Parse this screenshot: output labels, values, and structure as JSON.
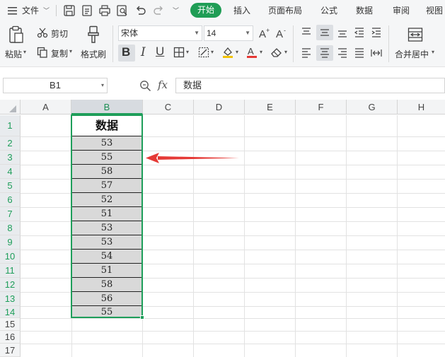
{
  "menubar": {
    "file_label": "文件",
    "tabs": [
      "开始",
      "插入",
      "页面布局",
      "公式",
      "数据",
      "审阅",
      "视图"
    ]
  },
  "ribbon": {
    "paste_label": "粘贴",
    "cut_label": "剪切",
    "copy_label": "复制",
    "format_painter_label": "格式刷",
    "font_name": "宋体",
    "font_size": "14",
    "merge_center_label": "合并居中"
  },
  "formula_bar": {
    "cell_ref": "B1",
    "fx_label": "fx",
    "content": "数据"
  },
  "sheet": {
    "columns": [
      "A",
      "B",
      "C",
      "D",
      "E",
      "F",
      "G",
      "H"
    ],
    "rows": [
      "1",
      "2",
      "3",
      "4",
      "5",
      "6",
      "7",
      "8",
      "9",
      "10",
      "11",
      "12",
      "13",
      "14",
      "15",
      "16",
      "17"
    ],
    "header_cell": "数据",
    "values": [
      "53",
      "55",
      "58",
      "57",
      "52",
      "51",
      "53",
      "53",
      "54",
      "51",
      "58",
      "56",
      "55"
    ]
  },
  "colors": {
    "accent": "#1f9d55",
    "selection": "#1e9e5a",
    "arrow": "#e53935"
  }
}
